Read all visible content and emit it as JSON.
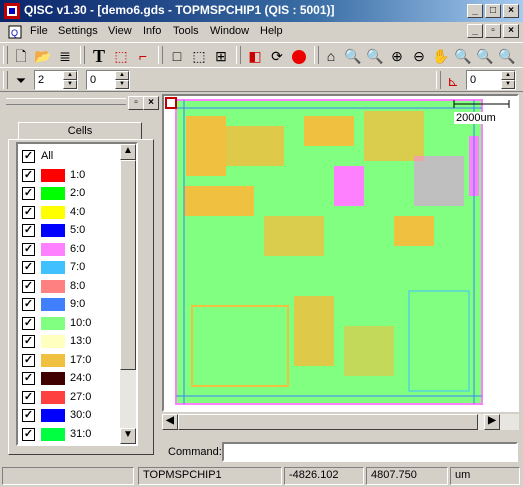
{
  "window": {
    "title": "QISC v1.30 - [demo6.gds - TOPMSPCHIP1 (QIS : 5001)]",
    "app_icon": "qis-app-icon"
  },
  "menu": [
    "File",
    "Settings",
    "View",
    "Info",
    "Tools",
    "Window",
    "Help"
  ],
  "filters": {
    "level_value": "2",
    "second_value": "0",
    "right_value": "0"
  },
  "panel": {
    "tab_label": "Cells",
    "items": [
      {
        "label": "All",
        "color": null
      },
      {
        "label": "1:0",
        "color": "#ff0000"
      },
      {
        "label": "2:0",
        "color": "#00ff00"
      },
      {
        "label": "4:0",
        "color": "#ffff00"
      },
      {
        "label": "5:0",
        "color": "#0000ff"
      },
      {
        "label": "6:0",
        "color": "#ff80ff"
      },
      {
        "label": "7:0",
        "color": "#40c0ff"
      },
      {
        "label": "8:0",
        "color": "#ff8080"
      },
      {
        "label": "9:0",
        "color": "#4080ff"
      },
      {
        "label": "10:0",
        "color": "#80ff80"
      },
      {
        "label": "13:0",
        "color": "#ffffc0"
      },
      {
        "label": "17:0",
        "color": "#f0c040"
      },
      {
        "label": "24:0",
        "color": "#400000"
      },
      {
        "label": "27:0",
        "color": "#ff4040"
      },
      {
        "label": "30:0",
        "color": "#0000ff"
      },
      {
        "label": "31:0",
        "color": "#00ff40"
      }
    ]
  },
  "viewport": {
    "scale_label": "2000um"
  },
  "command": {
    "label": "Command:",
    "value": ""
  },
  "status": {
    "cell": "TOPMSPCHIP1",
    "x": "-4826.102",
    "y": "4807.750",
    "units": "um"
  }
}
